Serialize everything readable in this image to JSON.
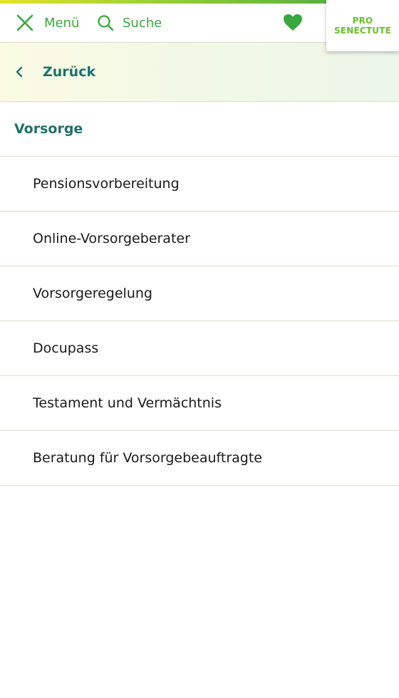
{
  "header": {
    "menu_label": "Menü",
    "search_label": "Suche",
    "logo": {
      "line1": "PRO",
      "line2": "SENECTUTE"
    },
    "icons": {
      "menu": "close-x-icon",
      "search": "magnifier-icon",
      "favorite": "heart-icon"
    }
  },
  "nav": {
    "back_label": "Zurück",
    "section_title": "Vorsorge",
    "items": [
      {
        "label": "Pensionsvorbereitung"
      },
      {
        "label": "Online-Vorsorgeberater"
      },
      {
        "label": "Vorsorgeregelung"
      },
      {
        "label": "Docupass"
      },
      {
        "label": "Testament und Vermächtnis"
      },
      {
        "label": "Beratung für Vorsorgebeauftragte"
      }
    ]
  },
  "colors": {
    "accent_green": "#3aa63f",
    "teal": "#1f6f6e",
    "logo_green": "#6cbd2b",
    "divider": "#dcdcc8"
  }
}
